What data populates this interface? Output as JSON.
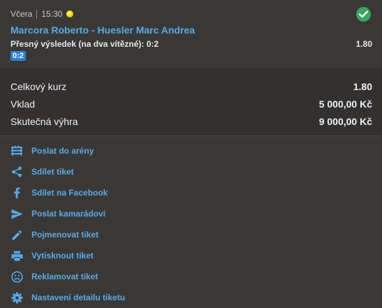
{
  "header": {
    "day": "Včera",
    "time": "15:30",
    "sport_icon": "tennis-ball-icon",
    "status_icon": "check-circle-icon"
  },
  "bet": {
    "match": "Marcora Roberto - Huesler Marc Andrea",
    "market": "Přesný výsledek (na dva vítězné): 0:2",
    "odd": "1.80",
    "pick": "0:2"
  },
  "summary": {
    "total_odds_label": "Celkový kurz",
    "total_odds_value": "1.80",
    "stake_label": "Vklad",
    "stake_value": "5 000,00 Kč",
    "win_label": "Skutečná výhra",
    "win_value": "9 000,00 Kč"
  },
  "actions": [
    {
      "label": "Poslat do arény",
      "icon": "arena-icon"
    },
    {
      "label": "Sdílet tiket",
      "icon": "share-icon"
    },
    {
      "label": "Sdílet na Facebook",
      "icon": "facebook-icon"
    },
    {
      "label": "Poslat kamarádovi",
      "icon": "send-icon"
    },
    {
      "label": "Pojmenovat tiket",
      "icon": "pencil-icon"
    },
    {
      "label": "Vytisknout tiket",
      "icon": "print-icon"
    },
    {
      "label": "Reklamovat tiket",
      "icon": "sad-face-icon"
    },
    {
      "label": "Nastavení detailu tiketu",
      "icon": "gear-icon"
    }
  ],
  "colors": {
    "background": "#3a3836",
    "summary_background": "#333130",
    "link": "#5aa9e6",
    "success": "#3aa55d",
    "pick_badge": "#2d7fd0"
  }
}
